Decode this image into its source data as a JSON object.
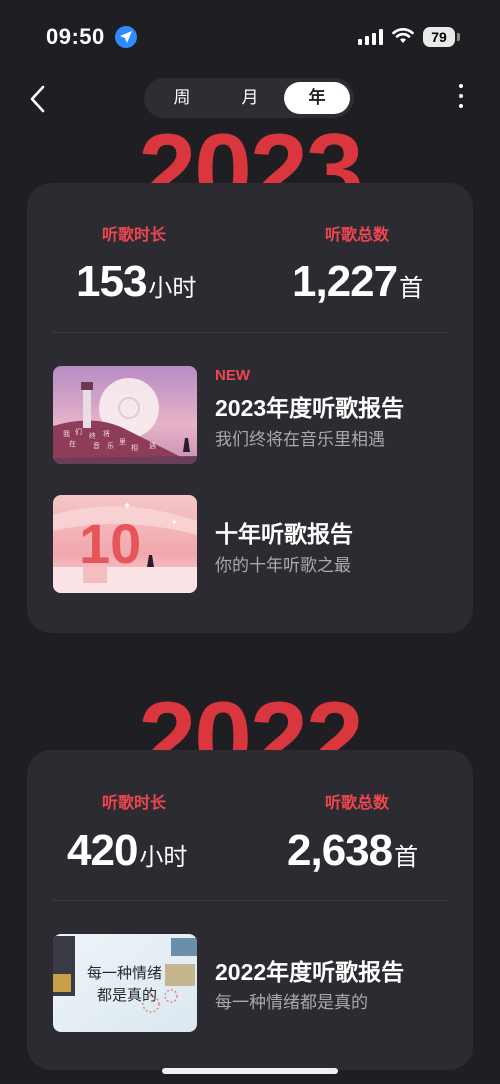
{
  "status_bar": {
    "time": "09:50",
    "battery": "79"
  },
  "nav": {
    "tabs": [
      "周",
      "月",
      "年"
    ],
    "active_tab": "年"
  },
  "years": [
    {
      "year": "2023",
      "duration_label": "听歌时长",
      "duration_value": "153",
      "duration_unit": "小时",
      "count_label": "听歌总数",
      "count_value": "1,227",
      "count_unit": "首",
      "reports": [
        {
          "badge": "NEW",
          "title": "2023年度听歌报告",
          "subtitle": "我们终将在音乐里相遇"
        },
        {
          "title": "十年听歌报告",
          "subtitle": "你的十年听歌之最"
        }
      ]
    },
    {
      "year": "2022",
      "duration_label": "听歌时长",
      "duration_value": "420",
      "duration_unit": "小时",
      "count_label": "听歌总数",
      "count_value": "2,638",
      "count_unit": "首",
      "reports": [
        {
          "title": "2022年度听歌报告",
          "subtitle": "每一种情绪都是真的"
        }
      ]
    }
  ],
  "thumbnails": {
    "report_2023_text": [
      "我",
      "们",
      "终",
      "将",
      "在",
      "音",
      "乐",
      "里",
      "相",
      "遇"
    ],
    "report_decade_text": "10",
    "report_2022_text": [
      "每一种情绪",
      "都是真的"
    ]
  },
  "colors": {
    "accent_red": "#ef4650",
    "year_red": "#d9363e",
    "card_bg": "#2b2b31",
    "page_bg": "#1e1e23"
  }
}
